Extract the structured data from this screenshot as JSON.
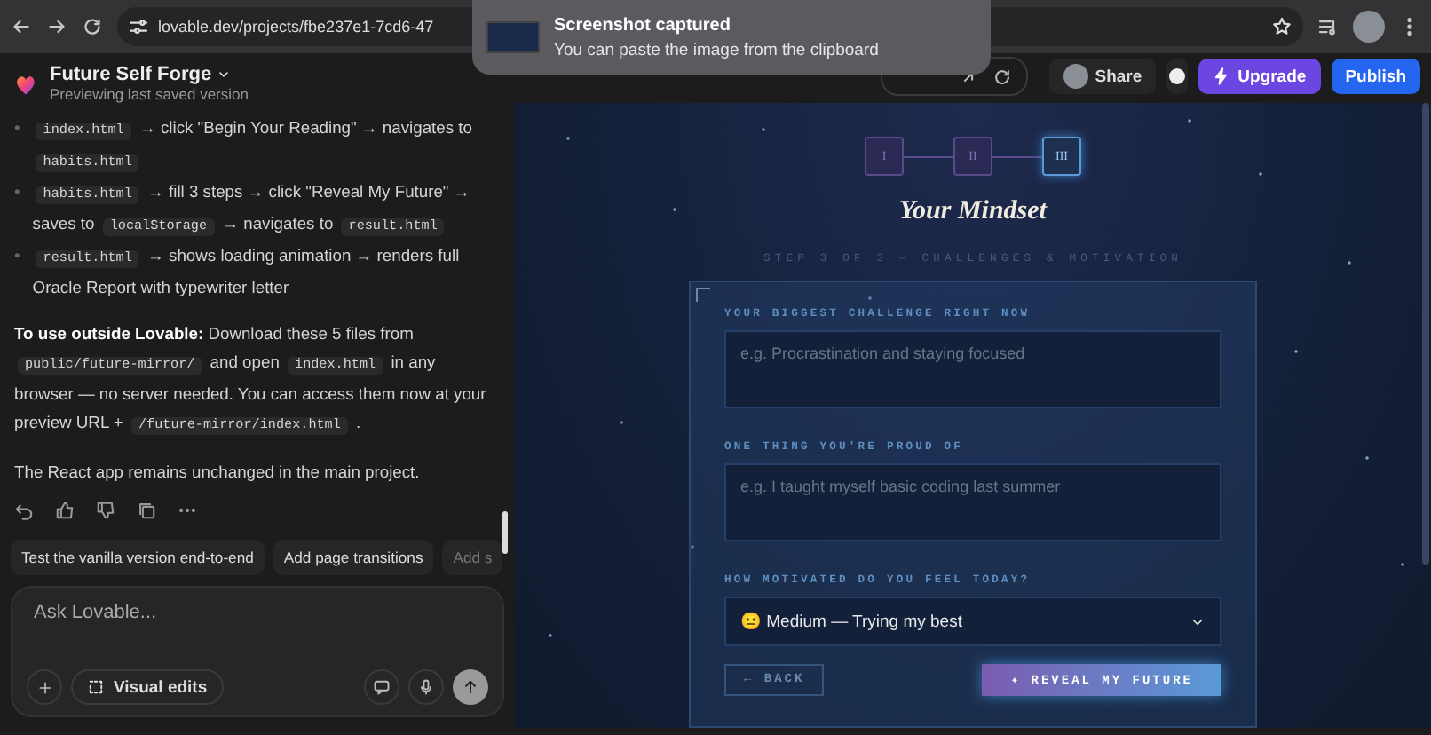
{
  "browser": {
    "url": "lovable.dev/projects/fbe237e1-7cd6-47"
  },
  "toast": {
    "title": "Screenshot captured",
    "message": "You can paste the image from the clipboard"
  },
  "project": {
    "name": "Future Self Forge",
    "status": "Previewing last saved version"
  },
  "chat": {
    "bullets": [
      {
        "marker": "•",
        "parts": [
          {
            "kind": "code",
            "text": "index.html"
          },
          {
            "kind": "text",
            "text": " → click \"Begin Your Reading\" → navigates to "
          },
          {
            "kind": "code",
            "text": "habits.html"
          }
        ]
      },
      {
        "marker": "•",
        "parts": [
          {
            "kind": "code",
            "text": "habits.html"
          },
          {
            "kind": "text",
            "text": " → fill 3 steps → click \"Reveal My Future\" → saves to "
          },
          {
            "kind": "code",
            "text": "localStorage"
          },
          {
            "kind": "text",
            "text": " → navigates to "
          },
          {
            "kind": "code",
            "text": "result.html"
          }
        ]
      },
      {
        "marker": "•",
        "parts": [
          {
            "kind": "code",
            "text": "result.html"
          },
          {
            "kind": "text",
            "text": " → shows loading animation → renders full Oracle Report with typewriter letter"
          }
        ]
      }
    ],
    "paragraphs": [
      [
        {
          "kind": "text",
          "text": "**To use outside Lovable:** Download these 5 files from "
        },
        {
          "kind": "code",
          "text": "public/future-mirror/"
        },
        {
          "kind": "text",
          "text": " and open "
        },
        {
          "kind": "code",
          "text": "index.html"
        },
        {
          "kind": "text",
          "text": " in any browser — no server needed. You can access them now at your preview URL + "
        },
        {
          "kind": "code",
          "text": "/future-mirror/index.html"
        },
        {
          "kind": "text",
          "text": " ."
        }
      ],
      [
        {
          "kind": "text",
          "text": "The React app remains unchanged in the main project."
        }
      ]
    ]
  },
  "suggestions": [
    "Test the vanilla version end-to-end",
    "Add page transitions",
    "Add s"
  ],
  "composer": {
    "placeholder": "Ask Lovable...",
    "visual_edits": "Visual edits"
  },
  "toolbar": {
    "share": "Share",
    "upgrade": "Upgrade",
    "publish": "Publish"
  },
  "preview": {
    "steps": [
      {
        "label": "I",
        "selected": false
      },
      {
        "label": "II",
        "selected": false
      },
      {
        "label": "III",
        "selected": true
      }
    ],
    "title": "Your Mindset",
    "subtitle": "STEP 3 OF 3 — CHALLENGES & MOTIVATION",
    "fields": [
      {
        "kind": "textarea",
        "label": "YOUR BIGGEST CHALLENGE RIGHT NOW",
        "placeholder": "e.g. Procrastination and staying focused"
      },
      {
        "kind": "textarea",
        "label": "ONE THING YOU'RE PROUD OF",
        "placeholder": "e.g. I taught myself basic coding last summer"
      },
      {
        "kind": "select",
        "label": "HOW MOTIVATED DO YOU FEEL TODAY?",
        "value": "😐 Medium — Trying my best"
      }
    ],
    "back": "← BACK",
    "reveal": "✦ REVEAL MY FUTURE"
  }
}
